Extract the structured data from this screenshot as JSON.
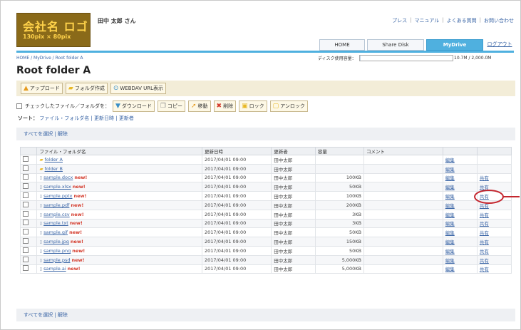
{
  "header": {
    "logo_line1": "会社名 ロゴ",
    "logo_line2": "130pix × 80pix",
    "user": "田中 太郎 さん",
    "toplinks": [
      "プレス",
      "マニュアル",
      "よくある質問",
      "お問い合わせ"
    ]
  },
  "tabs": [
    {
      "label": "HOME",
      "active": false
    },
    {
      "label": "Share Disk",
      "active": false
    },
    {
      "label": "MyDrive",
      "active": true
    },
    {
      "label": "ログアウト",
      "active": false
    }
  ],
  "breadcrumb": "HOME / MyDrive / Root folder A",
  "capacity": {
    "label": "ディスク使用容量：",
    "used_fraction": 0.005,
    "text": "10.7M / 2,000.0M"
  },
  "page_title": "Root folder A",
  "toolbar1": [
    {
      "label": "アップロード",
      "icon": "upload-icon"
    },
    {
      "label": "フォルダ作成",
      "icon": "new-folder-icon"
    },
    {
      "label": "WEBDAV URL表示",
      "icon": "link-icon"
    }
  ],
  "checked_label": "チェックしたファイル／フォルダを：",
  "toolbar2": [
    "ダウンロード",
    "コピー",
    "移動",
    "削除",
    "ロック",
    "アンロック"
  ],
  "sort": {
    "label": "ソート：",
    "options": [
      "ファイル・フォルダ名",
      "更新日時",
      "更新者"
    ]
  },
  "select_all": "すべてを選択",
  "unselect": "解除",
  "table": {
    "headers": [
      "",
      "ファイル・フォルダ名",
      "更新日時",
      "更新者",
      "容量",
      "コメント",
      "",
      ""
    ],
    "rows": [
      {
        "name": "folder A",
        "new": false,
        "date": "2017/04/01 09:00",
        "user": "田中太郎",
        "size": "",
        "edit": "編集",
        "share": ""
      },
      {
        "name": "folder B",
        "new": false,
        "date": "2017/04/01 09:00",
        "user": "田中太郎",
        "size": "",
        "edit": "編集",
        "share": ""
      },
      {
        "name": "sample.docx",
        "new": true,
        "date": "2017/04/01 09:00",
        "user": "田中太郎",
        "size": "100KB",
        "edit": "編集",
        "share": "共有"
      },
      {
        "name": "sample.xlsx",
        "new": true,
        "date": "2017/04/01 09:00",
        "user": "田中太郎",
        "size": "50KB",
        "edit": "編集",
        "share": "共有"
      },
      {
        "name": "sample.pptx",
        "new": true,
        "date": "2017/04/01 09:00",
        "user": "田中太郎",
        "size": "100KB",
        "edit": "編集",
        "share": "共有"
      },
      {
        "name": "sample.pdf",
        "new": true,
        "date": "2017/04/01 09:00",
        "user": "田中太郎",
        "size": "200KB",
        "edit": "編集",
        "share": "共有"
      },
      {
        "name": "sample.csv",
        "new": true,
        "date": "2017/04/01 09:00",
        "user": "田中太郎",
        "size": "3KB",
        "edit": "編集",
        "share": "共有"
      },
      {
        "name": "sample.txt",
        "new": true,
        "date": "2017/04/01 09:00",
        "user": "田中太郎",
        "size": "3KB",
        "edit": "編集",
        "share": "共有"
      },
      {
        "name": "sample.gif",
        "new": true,
        "date": "2017/04/01 09:00",
        "user": "田中太郎",
        "size": "50KB",
        "edit": "編集",
        "share": "共有"
      },
      {
        "name": "sample.jpg",
        "new": true,
        "date": "2017/04/01 09:00",
        "user": "田中太郎",
        "size": "150KB",
        "edit": "編集",
        "share": "共有"
      },
      {
        "name": "sample.png",
        "new": true,
        "date": "2017/04/01 09:00",
        "user": "田中太郎",
        "size": "50KB",
        "edit": "編集",
        "share": "共有"
      },
      {
        "name": "sample.psd",
        "new": true,
        "date": "2017/04/01 09:00",
        "user": "田中太郎",
        "size": "5,000KB",
        "edit": "編集",
        "share": "共有"
      },
      {
        "name": "sample.ai",
        "new": true,
        "date": "2017/04/01 09:00",
        "user": "田中太郎",
        "size": "5,000KB",
        "edit": "編集",
        "share": "共有"
      }
    ]
  },
  "new_badge": "new!",
  "colors": {
    "accent": "#4fb0df",
    "logo_bg": "#8a6a19",
    "callout": "#c4262e"
  }
}
